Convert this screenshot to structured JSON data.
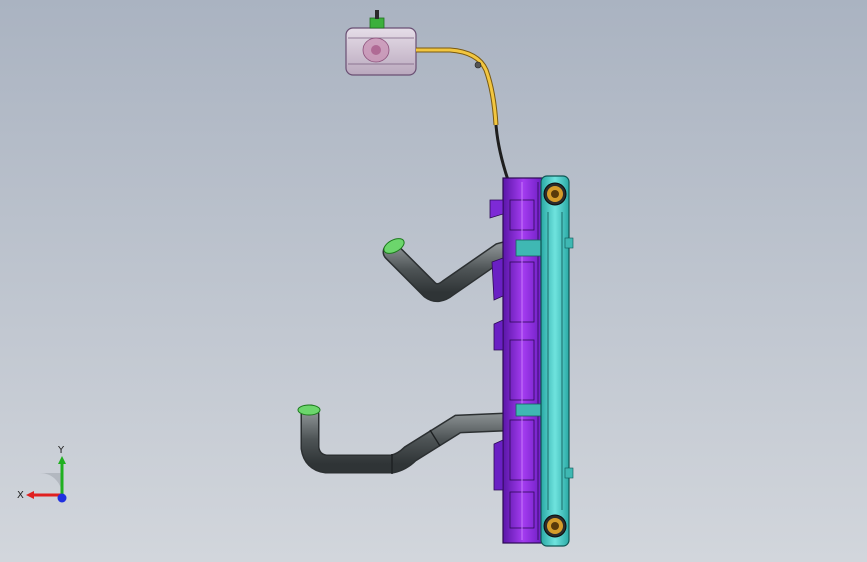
{
  "viewport": {
    "background_top": "#aab3c1",
    "background_bottom": "#d2d6dc"
  },
  "colors": {
    "radiator_core": "#47c9c4",
    "fan_shroud": "#8a2be2",
    "hose": "#555a5c",
    "overflow_line": "#e4b83a",
    "clamp": "#4fd64f",
    "reservoir": "#d8c7d8"
  },
  "triad": {
    "x_label": "X",
    "y_label": "Y",
    "x_color": "#e02020",
    "y_color": "#20b020",
    "z_color": "#2030e0"
  }
}
